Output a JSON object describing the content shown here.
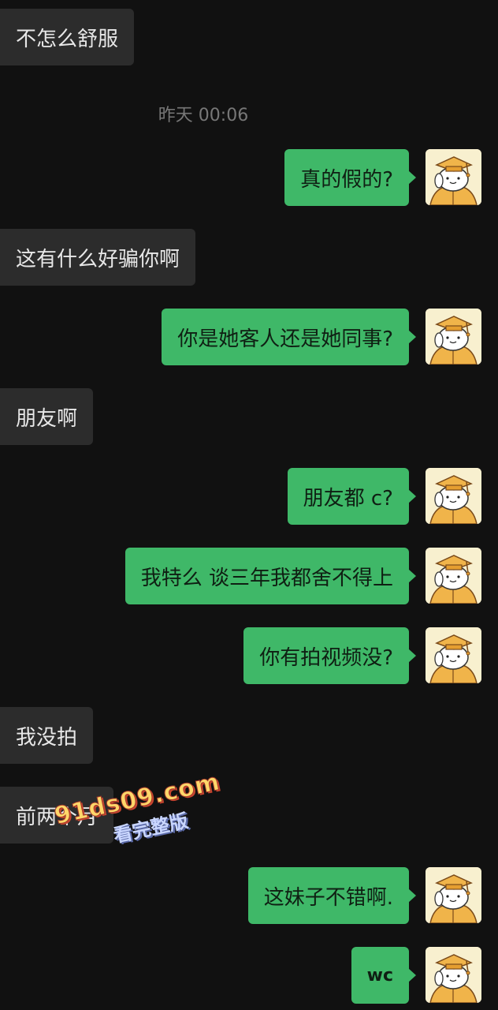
{
  "timestamp": "昨天 00:06",
  "messages": [
    {
      "side": "recv",
      "text": "不怎么舒服"
    },
    {
      "side": "sent",
      "text": "真的假的?"
    },
    {
      "side": "recv",
      "text": "这有什么好骗你啊"
    },
    {
      "side": "sent",
      "text": "你是她客人还是她同事?"
    },
    {
      "side": "recv",
      "text": "朋友啊"
    },
    {
      "side": "sent",
      "text": "朋友都 c?"
    },
    {
      "side": "sent",
      "text": "我特么 谈三年我都舍不得上"
    },
    {
      "side": "sent",
      "text": "你有拍视频没?"
    },
    {
      "side": "recv",
      "text": "我没拍"
    },
    {
      "side": "recv",
      "text": "前两个月"
    },
    {
      "side": "sent",
      "text": "这妹子不错啊."
    },
    {
      "side": "sent",
      "text": "wc"
    }
  ],
  "avatar_icon": "cartoon-dog-graduate-icon",
  "watermark": {
    "url": "91ds09.com",
    "subtitle": "看完整版"
  },
  "colors": {
    "background": "#111111",
    "sent_bubble": "#3fb868",
    "recv_bubble": "#2c2c2c",
    "timestamp": "#777777"
  }
}
